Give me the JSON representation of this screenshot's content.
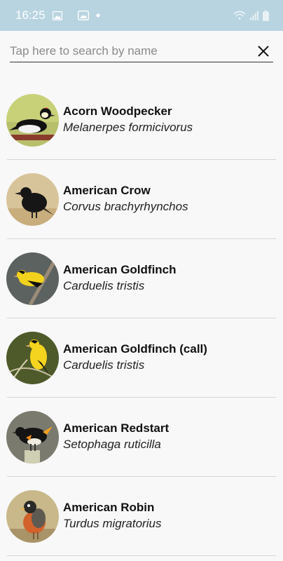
{
  "status_bar": {
    "time": "16:25",
    "icons_left": [
      "image-icon",
      "gallery-icon",
      "dot-icon"
    ],
    "icons_right": [
      "wifi-icon",
      "signal-icon",
      "battery-icon"
    ]
  },
  "search": {
    "placeholder": "Tap here to search by name",
    "value": ""
  },
  "birds": [
    {
      "common": "Acorn Woodpecker",
      "scientific": "Melanerpes formicivorus"
    },
    {
      "common": "American Crow",
      "scientific": "Corvus brachyrhynchos"
    },
    {
      "common": "American Goldfinch",
      "scientific": "Carduelis tristis"
    },
    {
      "common": "American Goldfinch (call)",
      "scientific": "Carduelis tristis"
    },
    {
      "common": "American Redstart",
      "scientific": "Setophaga ruticilla"
    },
    {
      "common": "American Robin",
      "scientific": "Turdus migratorius"
    }
  ],
  "colors": {
    "status_bar": "#b8d4e0",
    "background": "#f8f8f8",
    "divider": "#d6d6d6"
  }
}
